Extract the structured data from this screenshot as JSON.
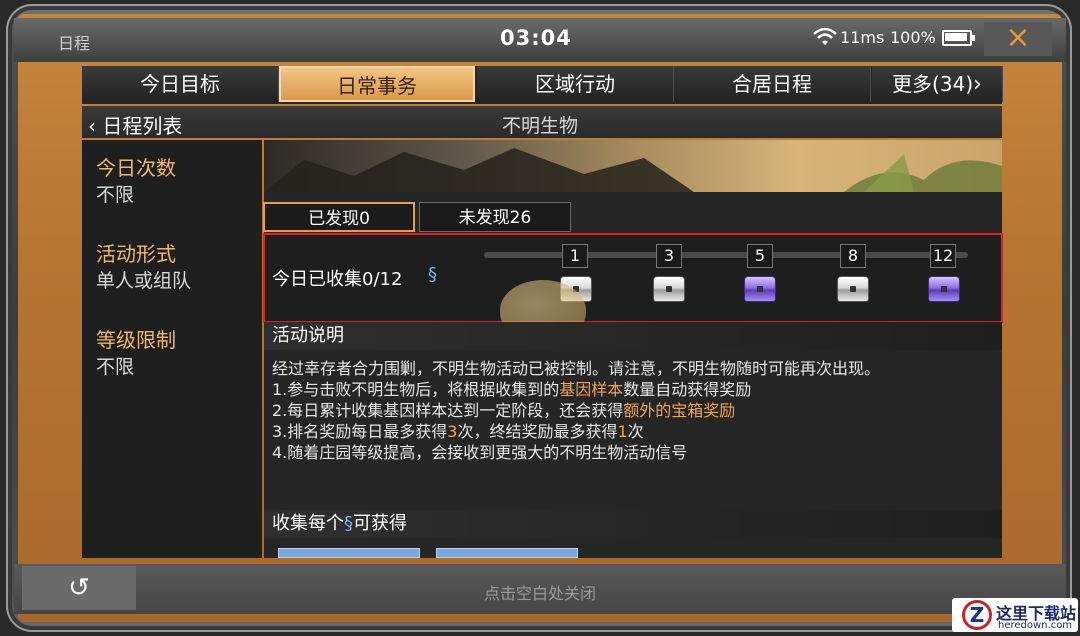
{
  "app_title": "日程",
  "status": {
    "time": "03:04",
    "ping": "11ms",
    "battery": "100%"
  },
  "close_icon": "×",
  "tabs": [
    {
      "label": "今日目标"
    },
    {
      "label": "日常事务",
      "active": true
    },
    {
      "label": "区域行动"
    },
    {
      "label": "合居日程"
    },
    {
      "label": "更多(34)"
    }
  ],
  "breadcrumb": {
    "back_label": "日程列表",
    "title": "不明生物"
  },
  "info": {
    "count_label": "今日次数",
    "count_value": "不限",
    "form_label": "活动形式",
    "form_value": "单人或组队",
    "level_label": "等级限制",
    "level_value": "不限"
  },
  "sub_tabs": {
    "found": "已发现0",
    "unfound": "未发现26"
  },
  "progress": {
    "collected_label": "今日已收集0/12",
    "current": 0,
    "max": 12,
    "milestones": [
      "1",
      "3",
      "5",
      "8",
      "12"
    ],
    "chest_types": [
      "silver",
      "silver",
      "purple",
      "silver",
      "purple"
    ]
  },
  "activity": {
    "heading": "活动说明",
    "intro": "经过幸存者合力围剿，不明生物活动已被控制。请注意，不明生物随时可能再次出现。",
    "rule1_a": "1.参与击败不明生物后，将根据收集到的",
    "rule1_hl": "基因样本",
    "rule1_b": "数量自动获得奖励",
    "rule2_a": "2.每日累计收集基因样本达到一定阶段，还会获得",
    "rule2_hl": "额外的宝箱奖励",
    "rule3_a": "3.排名奖励每日最多获得",
    "rule3_hl1": "3",
    "rule3_b": "次，终结奖励最多获得",
    "rule3_hl2": "1",
    "rule3_c": "次",
    "rule4": "4.随着庄园等级提高，会接收到更强大的不明生物活动信号"
  },
  "collect": {
    "heading_a": "收集每个",
    "heading_b": "可获得"
  },
  "bottom": {
    "back_icon": "↺",
    "close_hint": "点击空白处关闭"
  },
  "watermark": {
    "logo": "Z",
    "name": "这里下载站",
    "url": "heredown.com"
  },
  "colors": {
    "accent": "#f2a34e",
    "highlight_border": "#e02020",
    "panel": "#262626"
  }
}
